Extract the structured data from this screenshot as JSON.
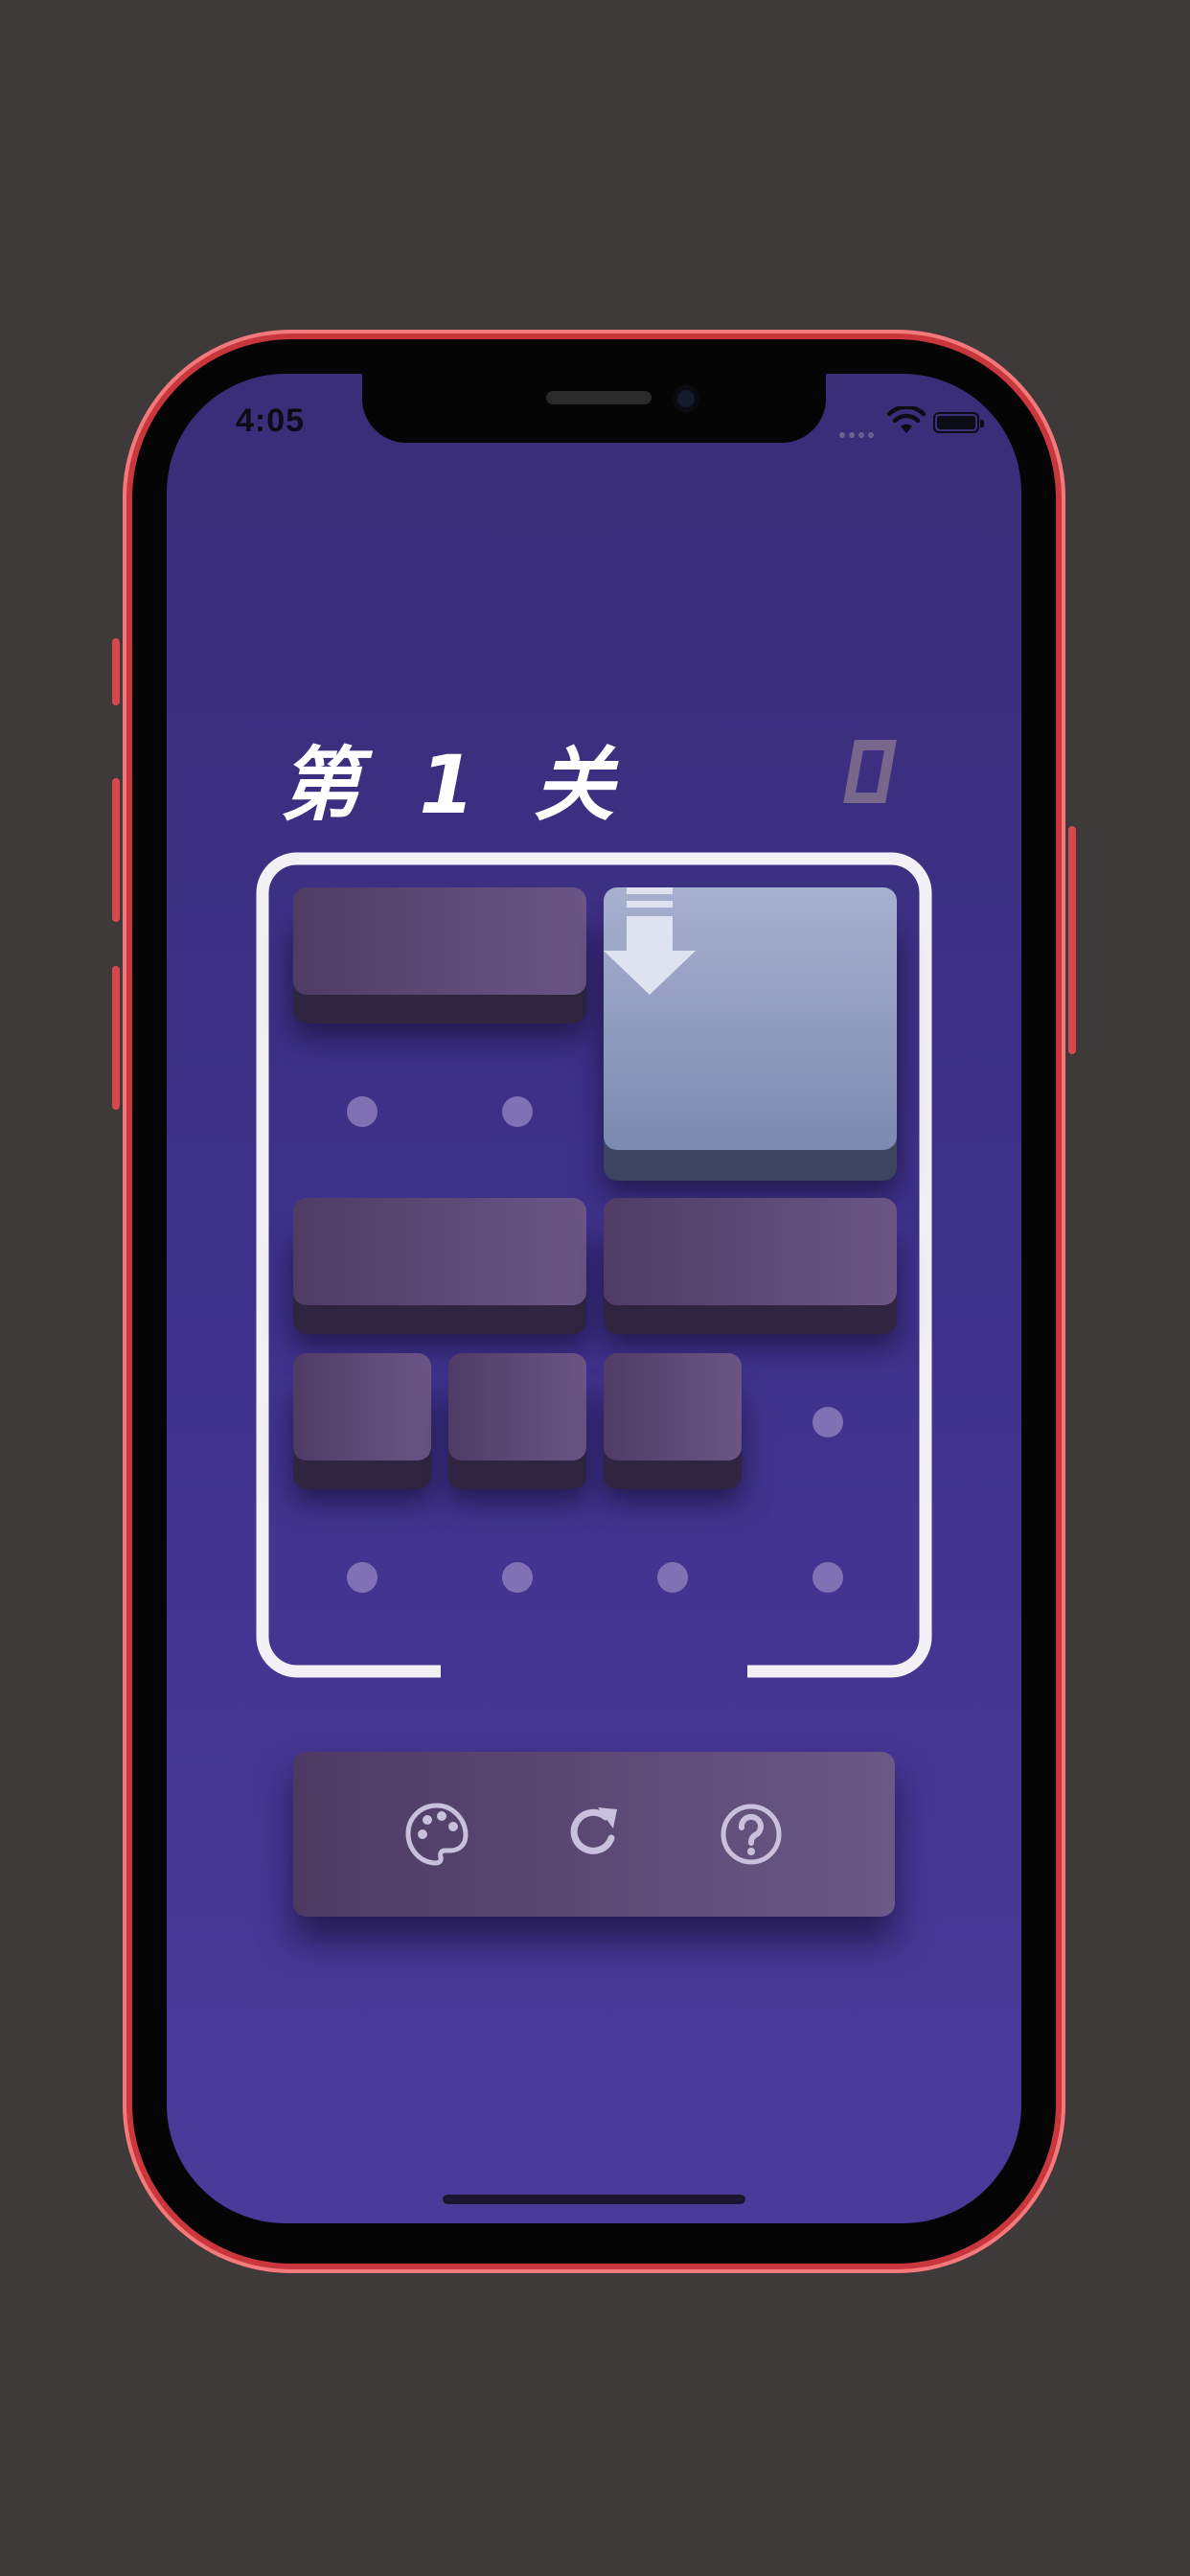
{
  "status_bar": {
    "time": "4:05"
  },
  "game": {
    "level_title": "第 1 关",
    "cells": {
      "blocks": [
        {
          "col": 0,
          "row": 0,
          "w": 2,
          "h": 1,
          "kind": "bar"
        },
        {
          "col": 2,
          "row": 0,
          "w": 2,
          "h": 2,
          "kind": "target"
        },
        {
          "col": 0,
          "row": 2,
          "w": 2,
          "h": 1,
          "kind": "bar"
        },
        {
          "col": 2,
          "row": 2,
          "w": 2,
          "h": 1,
          "kind": "bar"
        },
        {
          "col": 0,
          "row": 3,
          "w": 1,
          "h": 1,
          "kind": "small"
        },
        {
          "col": 1,
          "row": 3,
          "w": 1,
          "h": 1,
          "kind": "small"
        },
        {
          "col": 2,
          "row": 3,
          "w": 1,
          "h": 1,
          "kind": "small"
        }
      ],
      "empty_dots": [
        {
          "col": 0,
          "row": 1
        },
        {
          "col": 1,
          "row": 1
        },
        {
          "col": 3,
          "row": 3
        },
        {
          "col": 0,
          "row": 4
        },
        {
          "col": 1,
          "row": 4
        },
        {
          "col": 2,
          "row": 4
        },
        {
          "col": 3,
          "row": 4
        }
      ]
    }
  },
  "toolbar": {
    "items": [
      {
        "name": "palette-button",
        "icon": "palette-icon"
      },
      {
        "name": "restart-button",
        "icon": "refresh-icon"
      },
      {
        "name": "help-button",
        "icon": "help-icon"
      }
    ]
  },
  "colors": {
    "background": "#3e3a3a",
    "phone_frame": "#e2484d",
    "screen_top": "#3a2d78",
    "screen_bottom": "#4a3a9a",
    "block": "#5c4876",
    "target_block": "#9aa4c6",
    "dot": "#7f71b3",
    "board_border": "#f2f0f5",
    "icon": "#c8c0dc"
  }
}
